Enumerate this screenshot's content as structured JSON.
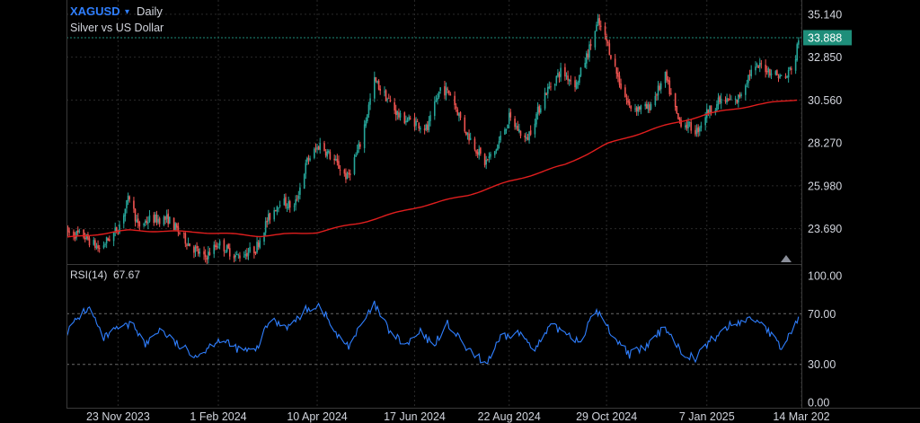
{
  "header": {
    "symbol": "XAGUSD",
    "dropdown_glyph": "▾",
    "interval": "Daily",
    "description": "Silver vs US Dollar"
  },
  "indicator": {
    "name": "RSI(14)",
    "value": "67.67"
  },
  "colors": {
    "background": "#000000",
    "up": "#26a69a",
    "down": "#ef5350",
    "ma_line": "#e01e1e",
    "rsi_line": "#2f7fff",
    "grid": "#2a2a2a",
    "last_price_badge": "#1e8e7a",
    "last_price_line": "#1e8e7a",
    "symbol_text": "#2f7fff"
  },
  "icons": {
    "scale_marker": "triangle-up-icon"
  },
  "chart_data": [
    {
      "type": "candlestick",
      "title": "XAGUSD Daily",
      "subtitle": "Silver vs US Dollar",
      "x_range": [
        "2023-10-18",
        "2025-03-14"
      ],
      "y_range": [
        21.8,
        35.9
      ],
      "y_ticks": [
        "35.140",
        "32.850",
        "30.560",
        "28.270",
        "25.980",
        "23.690"
      ],
      "x_tick_labels": [
        "23 Nov 2023",
        "1 Feb 2024",
        "10 Apr 2024",
        "17 Jun 2024",
        "22 Aug 2024",
        "29 Oct 2024",
        "7 Jan 2025",
        "14 Mar 202"
      ],
      "x_tick_dates": [
        "2023-11-23",
        "2024-02-01",
        "2024-04-10",
        "2024-06-17",
        "2024-08-22",
        "2024-10-29",
        "2025-01-07",
        "2025-03-14"
      ],
      "last_price": "33.888",
      "grid": true,
      "close_series": [
        [
          "2023-10-18",
          23.5
        ],
        [
          "2023-10-30",
          23.3
        ],
        [
          "2023-11-10",
          22.6
        ],
        [
          "2023-11-23",
          23.7
        ],
        [
          "2023-12-01",
          25.4
        ],
        [
          "2023-12-07",
          23.8
        ],
        [
          "2023-12-15",
          24.2
        ],
        [
          "2023-12-28",
          24.2
        ],
        [
          "2024-01-10",
          23.0
        ],
        [
          "2024-01-22",
          22.1
        ],
        [
          "2024-02-01",
          22.9
        ],
        [
          "2024-02-14",
          22.2
        ],
        [
          "2024-02-27",
          22.6
        ],
        [
          "2024-03-06",
          24.1
        ],
        [
          "2024-03-15",
          25.2
        ],
        [
          "2024-03-25",
          24.8
        ],
        [
          "2024-04-03",
          27.3
        ],
        [
          "2024-04-12",
          28.2
        ],
        [
          "2024-04-22",
          27.3
        ],
        [
          "2024-05-01",
          26.4
        ],
        [
          "2024-05-10",
          28.2
        ],
        [
          "2024-05-20",
          31.6
        ],
        [
          "2024-05-31",
          30.4
        ],
        [
          "2024-06-07",
          29.6
        ],
        [
          "2024-06-17",
          29.4
        ],
        [
          "2024-06-26",
          29.0
        ],
        [
          "2024-07-05",
          31.2
        ],
        [
          "2024-07-12",
          30.9
        ],
        [
          "2024-07-22",
          29.0
        ],
        [
          "2024-08-05",
          27.2
        ],
        [
          "2024-08-12",
          27.8
        ],
        [
          "2024-08-22",
          29.6
        ],
        [
          "2024-09-03",
          28.4
        ],
        [
          "2024-09-16",
          30.9
        ],
        [
          "2024-09-27",
          32.1
        ],
        [
          "2024-10-08",
          31.4
        ],
        [
          "2024-10-17",
          33.3
        ],
        [
          "2024-10-23",
          34.7
        ],
        [
          "2024-10-29",
          33.7
        ],
        [
          "2024-11-08",
          31.3
        ],
        [
          "2024-11-14",
          30.2
        ],
        [
          "2024-11-27",
          30.1
        ],
        [
          "2024-12-09",
          31.8
        ],
        [
          "2024-12-18",
          29.5
        ],
        [
          "2024-12-31",
          28.9
        ],
        [
          "2025-01-07",
          29.9
        ],
        [
          "2025-01-16",
          30.5
        ],
        [
          "2025-01-28",
          30.5
        ],
        [
          "2025-02-06",
          32.0
        ],
        [
          "2025-02-14",
          32.4
        ],
        [
          "2025-02-25",
          31.9
        ],
        [
          "2025-03-03",
          31.7
        ],
        [
          "2025-03-10",
          32.8
        ],
        [
          "2025-03-12",
          33.9
        ]
      ],
      "ma_series": [
        [
          "2023-10-18",
          23.2
        ],
        [
          "2023-12-01",
          23.6
        ],
        [
          "2024-01-20",
          23.5
        ],
        [
          "2024-03-01",
          23.3
        ],
        [
          "2024-04-10",
          23.5
        ],
        [
          "2024-05-10",
          24.0
        ],
        [
          "2024-06-17",
          24.8
        ],
        [
          "2024-07-25",
          25.5
        ],
        [
          "2024-08-22",
          26.2
        ],
        [
          "2024-09-30",
          27.1
        ],
        [
          "2024-10-29",
          28.2
        ],
        [
          "2024-11-30",
          29.0
        ],
        [
          "2025-01-07",
          29.8
        ],
        [
          "2025-02-10",
          30.3
        ],
        [
          "2025-03-12",
          30.6
        ]
      ]
    },
    {
      "type": "line",
      "title": "RSI(14)",
      "x_range": [
        "2023-10-18",
        "2025-03-14"
      ],
      "y_range": [
        0,
        100
      ],
      "y_ticks": [
        "100.00",
        "70.00",
        "30.00",
        "0.00"
      ],
      "levels": [
        70,
        30
      ],
      "current": "67.67",
      "series": [
        [
          "2023-10-18",
          55
        ],
        [
          "2023-10-30",
          72
        ],
        [
          "2023-11-04",
          74
        ],
        [
          "2023-11-12",
          50
        ],
        [
          "2023-11-23",
          58
        ],
        [
          "2023-12-04",
          62
        ],
        [
          "2023-12-12",
          45
        ],
        [
          "2023-12-22",
          58
        ],
        [
          "2024-01-05",
          44
        ],
        [
          "2024-01-18",
          37
        ],
        [
          "2024-02-01",
          50
        ],
        [
          "2024-02-15",
          42
        ],
        [
          "2024-02-27",
          40
        ],
        [
          "2024-03-08",
          65
        ],
        [
          "2024-03-22",
          60
        ],
        [
          "2024-04-03",
          74
        ],
        [
          "2024-04-12",
          77
        ],
        [
          "2024-04-24",
          52
        ],
        [
          "2024-05-02",
          45
        ],
        [
          "2024-05-20",
          77
        ],
        [
          "2024-05-31",
          55
        ],
        [
          "2024-06-11",
          45
        ],
        [
          "2024-06-21",
          55
        ],
        [
          "2024-06-30",
          45
        ],
        [
          "2024-07-10",
          62
        ],
        [
          "2024-07-25",
          40
        ],
        [
          "2024-08-06",
          31
        ],
        [
          "2024-08-16",
          50
        ],
        [
          "2024-08-28",
          55
        ],
        [
          "2024-09-10",
          43
        ],
        [
          "2024-09-20",
          60
        ],
        [
          "2024-10-02",
          55
        ],
        [
          "2024-10-10",
          48
        ],
        [
          "2024-10-22",
          73
        ],
        [
          "2024-11-01",
          55
        ],
        [
          "2024-11-14",
          38
        ],
        [
          "2024-11-25",
          43
        ],
        [
          "2024-12-09",
          60
        ],
        [
          "2024-12-20",
          40
        ],
        [
          "2024-12-30",
          35
        ],
        [
          "2025-01-09",
          48
        ],
        [
          "2025-01-22",
          60
        ],
        [
          "2025-02-05",
          66
        ],
        [
          "2025-02-14",
          64
        ],
        [
          "2025-02-28",
          42
        ],
        [
          "2025-03-05",
          52
        ],
        [
          "2025-03-12",
          67.67
        ]
      ]
    }
  ]
}
